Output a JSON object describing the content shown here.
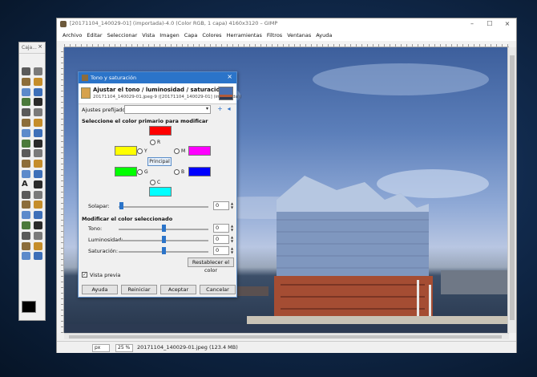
{
  "toolbox": {
    "title": "Caja...",
    "close": "×"
  },
  "window": {
    "title": "[20171104_140029-01] (importada)-4.0 (Color RGB, 1 capa) 4160x3120 – GIMP",
    "minimize": "–",
    "maximize": "☐",
    "close": "×"
  },
  "menubar": [
    "Archivo",
    "Editar",
    "Seleccionar",
    "Vista",
    "Imagen",
    "Capa",
    "Colores",
    "Herramientas",
    "Filtros",
    "Ventanas",
    "Ayuda"
  ],
  "statusbar": {
    "unit": "px",
    "zoom": "25 %",
    "info": "20171104_140029-01.jpeg (123.4 MB)"
  },
  "dialog": {
    "title": "Tono y saturación",
    "close": "×",
    "header_title": "Ajustar el tono / luminosidad / saturación",
    "header_subtitle": "20171104_140029-01.jpeg-9 ([20171104_140029-01] (importada))",
    "presets_label": "Ajustes prefijados:",
    "add_preset": "+",
    "preset_menu": "◂",
    "select_primary_label": "Seleccione el color primario para modificar",
    "radios": {
      "r": "R",
      "y": "Y",
      "m": "M",
      "g": "G",
      "b": "B",
      "c": "C"
    },
    "master_button": "Principal",
    "overlap_label": "Solapar:",
    "overlap_value": "0",
    "modify_label": "Modificar el color seleccionado",
    "hue_label": "Tono:",
    "hue_value": "0",
    "lightness_label": "Luminosidad:",
    "lightness_value": "0",
    "saturation_label": "Saturación:",
    "saturation_value": "0",
    "reset_color": "Restablecer el color",
    "preview_label": "Vista previa",
    "preview_checked": "✓",
    "help": "Ayuda",
    "reset": "Reiniciar",
    "ok": "Aceptar",
    "cancel": "Cancelar"
  },
  "colors": {
    "red": "#ff0000",
    "yellow": "#ffff00",
    "magenta": "#ff00ff",
    "green": "#00ff00",
    "blue": "#0000ff",
    "cyan": "#00ffff",
    "accent": "#2b74c9"
  },
  "tools": [
    "rect-select-icon",
    "ellipse-select-icon",
    "free-select-icon",
    "fuzzy-select-icon",
    "color-select-icon",
    "scissors-icon",
    "foreground-select-icon",
    "paths-icon",
    "color-picker-icon",
    "zoom-icon",
    "measure-icon",
    "move-icon",
    "align-icon",
    "crop-icon",
    "rotate-icon",
    "scale-icon",
    "shear-icon",
    "perspective-icon",
    "flip-icon",
    "cage-icon",
    "warp-icon",
    "unified-transform-icon",
    "text-icon",
    "bucket-fill-icon",
    "gradient-icon",
    "pencil-icon",
    "paintbrush-icon",
    "eraser-icon",
    "airbrush-icon",
    "ink-icon",
    "mypaint-brush-icon",
    "clone-icon",
    "heal-icon",
    "perspective-clone-icon",
    "blur-icon",
    "smudge-icon",
    "dodge-burn-icon",
    "swap-colors-icon"
  ]
}
